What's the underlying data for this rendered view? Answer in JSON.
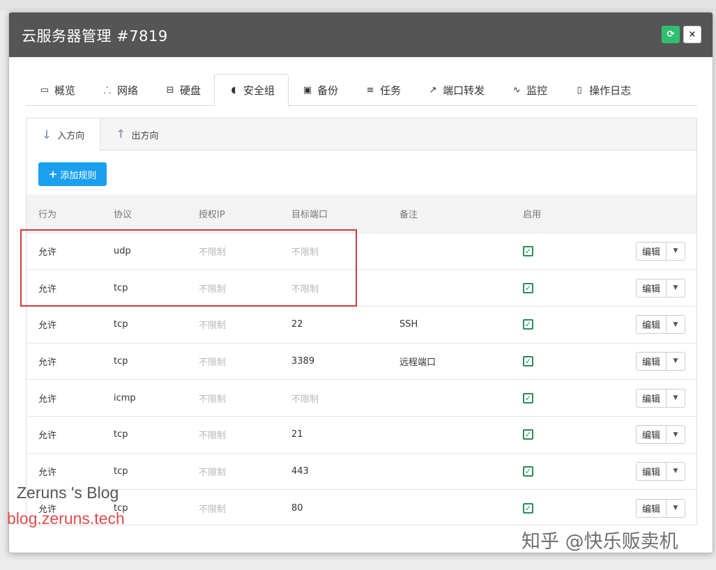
{
  "modal": {
    "title": "云服务器管理 #7819",
    "refresh_icon": "refresh-icon",
    "close_label": "×"
  },
  "tabs": [
    {
      "label": "概览",
      "icon": "monitor-icon"
    },
    {
      "label": "网络",
      "icon": "sitemap-icon"
    },
    {
      "label": "硬盘",
      "icon": "hdd-icon"
    },
    {
      "label": "安全组",
      "icon": "shield-icon",
      "active": true
    },
    {
      "label": "备份",
      "icon": "floppy-icon"
    },
    {
      "label": "任务",
      "icon": "list-icon"
    },
    {
      "label": "端口转发",
      "icon": "external-link-icon"
    },
    {
      "label": "监控",
      "icon": "pulse-icon"
    },
    {
      "label": "操作日志",
      "icon": "document-icon"
    }
  ],
  "subtabs": [
    {
      "label": "入方向",
      "icon": "arrow-down-icon",
      "active": true
    },
    {
      "label": "出方向",
      "icon": "arrow-up-icon"
    }
  ],
  "add_button": {
    "label": "添加规则",
    "icon": "plus-icon"
  },
  "table": {
    "headers": [
      "行为",
      "协议",
      "授权IP",
      "目标端口",
      "备注",
      "启用"
    ],
    "rows": [
      {
        "action": "允许",
        "protocol": "udp",
        "ip": "不限制",
        "port": "不限制",
        "note": "",
        "enabled": true
      },
      {
        "action": "允许",
        "protocol": "tcp",
        "ip": "不限制",
        "port": "不限制",
        "note": "",
        "enabled": true
      },
      {
        "action": "允许",
        "protocol": "tcp",
        "ip": "不限制",
        "port": "22",
        "note": "SSH",
        "enabled": true
      },
      {
        "action": "允许",
        "protocol": "tcp",
        "ip": "不限制",
        "port": "3389",
        "note": "远程端口",
        "enabled": true
      },
      {
        "action": "允许",
        "protocol": "icmp",
        "ip": "不限制",
        "port": "不限制",
        "note": "",
        "enabled": true
      },
      {
        "action": "允许",
        "protocol": "tcp",
        "ip": "不限制",
        "port": "21",
        "note": "",
        "enabled": true
      },
      {
        "action": "允许",
        "protocol": "tcp",
        "ip": "不限制",
        "port": "443",
        "note": "",
        "enabled": true
      },
      {
        "action": "允许",
        "protocol": "tcp",
        "ip": "不限制",
        "port": "80",
        "note": "",
        "enabled": true
      }
    ],
    "edit_label": "编辑"
  },
  "watermarks": {
    "blog_name": "Zeruns 's Blog",
    "blog_url": "blog.zeruns.tech",
    "zhihu": "知乎 @快乐贩卖机"
  },
  "colors": {
    "header_bg": "#555555",
    "refresh_green": "#2fbf71",
    "add_button_blue": "#1aa0ee",
    "check_green": "#2e8b57",
    "highlight_red": "#d23a3a"
  }
}
